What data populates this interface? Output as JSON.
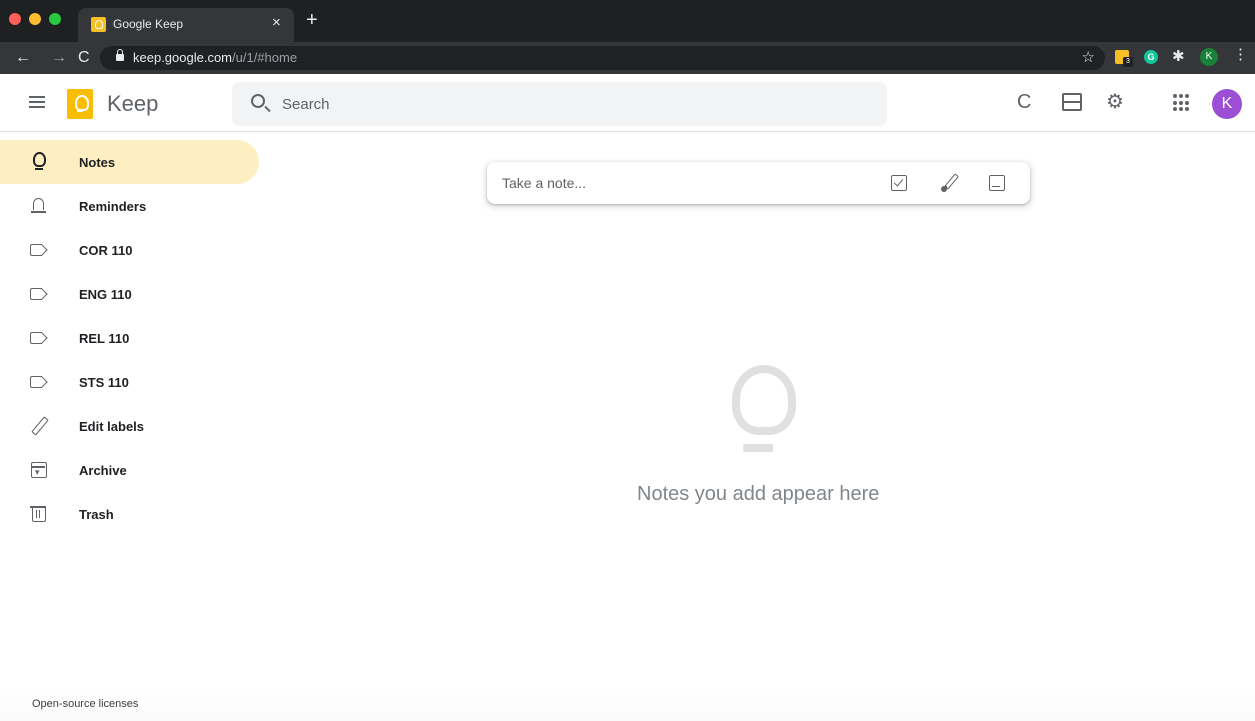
{
  "browser": {
    "tab_title": "Google Keep",
    "tab_close": "×",
    "new_tab": "+",
    "url_host": "keep.google.com",
    "url_path": "/u/1/#home",
    "nav_back": "←",
    "nav_forward": "→",
    "nav_reload": "C",
    "bookmark": "☆",
    "ext_keep_count": "3",
    "ext_grammarly": "G",
    "ext_puzzle": "✱",
    "ext_profile": "K",
    "menu": "⋮"
  },
  "header": {
    "app_name": "Keep",
    "search_placeholder": "Search",
    "refresh": "C",
    "settings": "⚙",
    "avatar": "K"
  },
  "sidebar": {
    "items": [
      {
        "label": "Notes",
        "icon": "bulb-icon",
        "active": true
      },
      {
        "label": "Reminders",
        "icon": "bell-icon"
      },
      {
        "label": "COR 110",
        "icon": "label-icon"
      },
      {
        "label": "ENG 110",
        "icon": "label-icon"
      },
      {
        "label": "REL 110",
        "icon": "label-icon"
      },
      {
        "label": "STS 110",
        "icon": "label-icon"
      },
      {
        "label": "Edit labels",
        "icon": "pencil-icon"
      },
      {
        "label": "Archive",
        "icon": "archive-icon"
      },
      {
        "label": "Trash",
        "icon": "trash-icon"
      }
    ]
  },
  "main": {
    "note_placeholder": "Take a note...",
    "empty_message": "Notes you add appear here"
  },
  "footer": {
    "licenses": "Open-source licenses"
  },
  "colors": {
    "accent": "#feefc3",
    "keep_yellow": "#fbbc04",
    "avatar": "#9c4fd4"
  }
}
